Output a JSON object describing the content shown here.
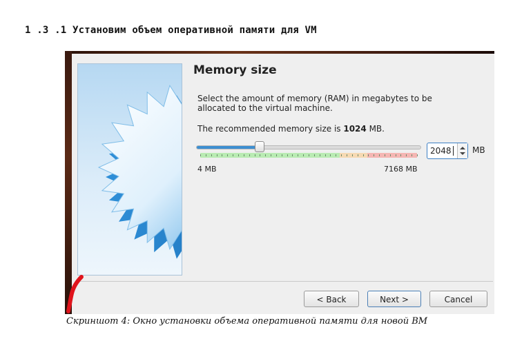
{
  "document": {
    "heading": "1 .3 .1 Установим объем оперативной памяти для VM",
    "caption": "Скриншот 4: Окно установки объема оперативной памяти для новой ВМ"
  },
  "dialog": {
    "title": "Memory size",
    "description": "Select the amount of memory (RAM) in megabytes to be allocated to the virtual machine.",
    "recommended_prefix": "The recommended memory size is ",
    "recommended_value": "1024",
    "recommended_suffix": " MB.",
    "memory_value": "2048",
    "memory_unit": "MB",
    "slider": {
      "min": 4,
      "max": 7168,
      "value": 2048,
      "min_label": "4 MB",
      "max_label": "7168 MB"
    },
    "buttons": {
      "back": "< Back",
      "next": "Next >",
      "cancel": "Cancel"
    }
  },
  "colors": {
    "accent": "#3d8fd1",
    "safe_zone": "#b9ebb3",
    "warn_zone": "#f6d9b3",
    "danger_zone": "#f5b6b3",
    "mark": "#e0141c"
  },
  "icons": {
    "wizard_art": "starburst-icon",
    "annotation": "red-pen-mark-icon"
  }
}
